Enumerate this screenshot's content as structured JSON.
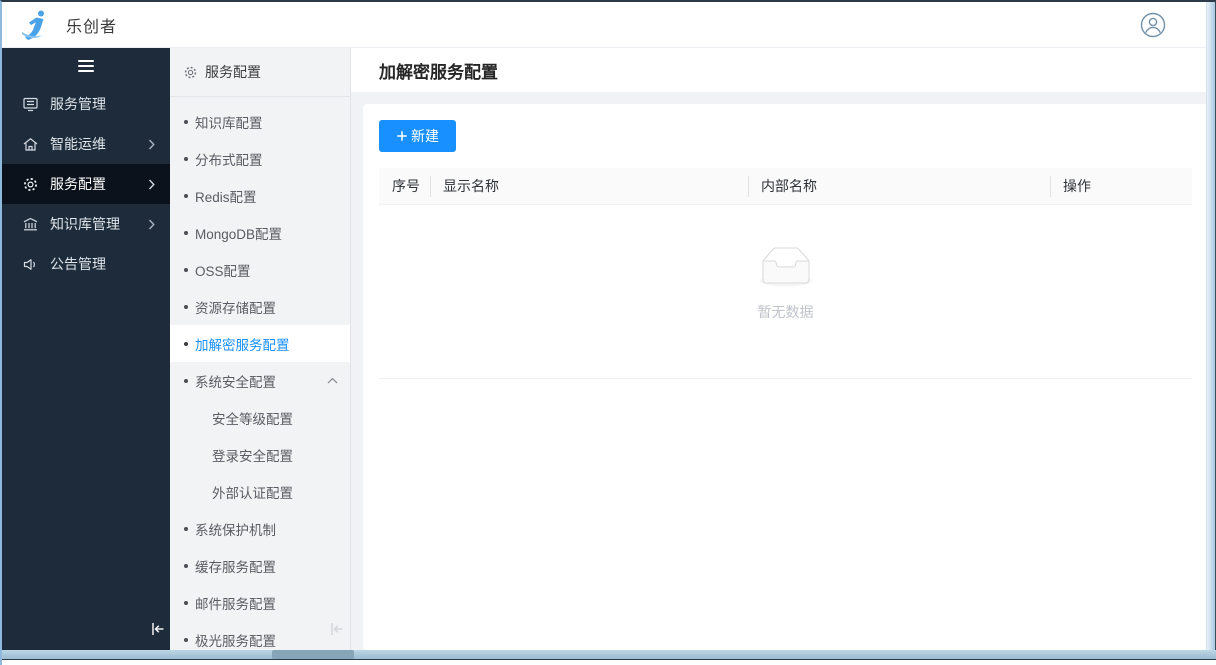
{
  "header": {
    "logo_text": "乐创者"
  },
  "sidebar": {
    "items": [
      {
        "label": "服务管理",
        "icon": "server-icon"
      },
      {
        "label": "智能运维",
        "icon": "ops-home-icon"
      },
      {
        "label": "服务配置",
        "icon": "gear-icon"
      },
      {
        "label": "知识库管理",
        "icon": "library-icon"
      },
      {
        "label": "公告管理",
        "icon": "announcement-icon"
      }
    ]
  },
  "submenu": {
    "title": "服务配置",
    "items": [
      "知识库配置",
      "分布式配置",
      "Redis配置",
      "MongoDB配置",
      "OSS配置",
      "资源存储配置",
      "加解密服务配置",
      "系统安全配置",
      "安全等级配置",
      "登录安全配置",
      "外部认证配置",
      "系统保护机制",
      "缓存服务配置",
      "邮件服务配置",
      "极光服务配置"
    ],
    "active_item": "加解密服务配置",
    "expanded_group": "系统安全配置"
  },
  "main": {
    "page_title": "加解密服务配置",
    "new_button_label": "新建",
    "table": {
      "columns": [
        "序号",
        "显示名称",
        "内部名称",
        "操作"
      ],
      "rows": [],
      "empty_text": "暂无数据"
    }
  },
  "colors": {
    "primary": "#1890ff",
    "sidebar_bg": "#1d2b3b",
    "sidebar_active_bg": "#0c121b",
    "submenu_bg": "#f2f3f5",
    "main_bg": "#f0f2f5",
    "active_text": "#1890ff",
    "empty_text": "#bfc3cb"
  }
}
